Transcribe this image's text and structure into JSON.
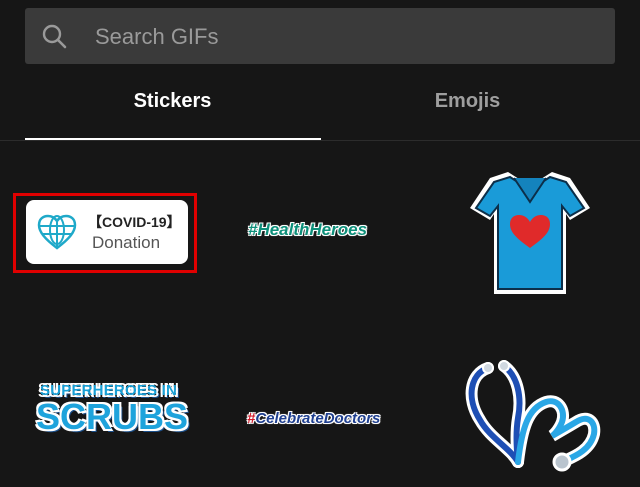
{
  "search": {
    "placeholder": "Search GIFs"
  },
  "tabs": [
    {
      "label": "Stickers",
      "active": true
    },
    {
      "label": "Emojis",
      "active": false
    }
  ],
  "stickers": {
    "covid_donation": {
      "line1": "【COVID-19】",
      "line2": "Donation",
      "selected": true
    },
    "health_heroes": {
      "text": "#HealthHeroes"
    },
    "scrubs_shirt": {
      "icon": "scrubs-heart-icon"
    },
    "superheroes": {
      "line1": "SUPERHEROES IN",
      "line2": "SCRUBS"
    },
    "celebrate_doctors": {
      "hash": "#",
      "text": "CelebrateDoctors"
    },
    "stethoscope": {
      "icon": "stethoscope-heart-icon"
    }
  },
  "colors": {
    "background": "#161616",
    "search_bg": "#3a3a3a",
    "active_tab": "#ffffff",
    "inactive_tab": "#9e9e9e",
    "selection": "#e00000"
  }
}
